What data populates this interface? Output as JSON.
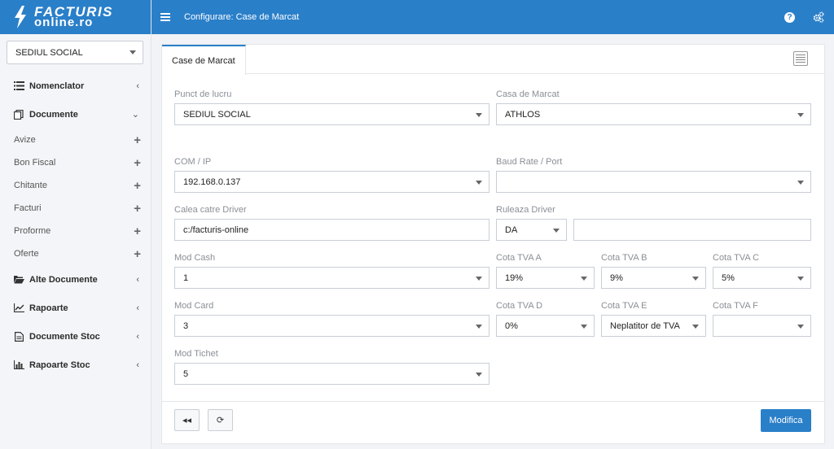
{
  "brand": {
    "line1": "FACTURIS",
    "line2": "online.ro"
  },
  "header": {
    "title": "Configurare: Case de Marcat"
  },
  "sidebar": {
    "site": "SEDIUL SOCIAL",
    "items": [
      {
        "label": "Nomenclator"
      },
      {
        "label": "Documente"
      },
      {
        "label": "Alte Documente"
      },
      {
        "label": "Rapoarte"
      },
      {
        "label": "Documente Stoc"
      },
      {
        "label": "Rapoarte Stoc"
      }
    ],
    "documente_sub": [
      {
        "label": "Avize"
      },
      {
        "label": "Bon Fiscal"
      },
      {
        "label": "Chitante"
      },
      {
        "label": "Facturi"
      },
      {
        "label": "Proforme"
      },
      {
        "label": "Oferte"
      }
    ]
  },
  "tab": {
    "label": "Case de Marcat"
  },
  "form": {
    "punct_label": "Punct de lucru",
    "punct_value": "SEDIUL SOCIAL",
    "casa_label": "Casa de Marcat",
    "casa_value": "ATHLOS",
    "com_label": "COM / IP",
    "com_value": "192.168.0.137",
    "baud_label": "Baud Rate / Port",
    "baud_value": "",
    "driver_label": "Calea catre Driver",
    "driver_value": "c:/facturis-online",
    "ruleaza_label": "Ruleaza Driver",
    "ruleaza_value": "DA",
    "ruleaza_extra": "",
    "modcash_label": "Mod Cash",
    "modcash_value": "1",
    "tvaA_label": "Cota TVA A",
    "tvaA_value": "19%",
    "tvaB_label": "Cota TVA B",
    "tvaB_value": "9%",
    "tvaC_label": "Cota TVA C",
    "tvaC_value": "5%",
    "modcard_label": "Mod Card",
    "modcard_value": "3",
    "tvaD_label": "Cota TVA D",
    "tvaD_value": "0%",
    "tvaE_label": "Cota TVA E",
    "tvaE_value": "Neplatitor de TVA",
    "tvaF_label": "Cota TVA F",
    "tvaF_value": "",
    "modtichet_label": "Mod Tichet",
    "modtichet_value": "5"
  },
  "actions": {
    "back": "◂◂",
    "refresh": "⟳",
    "submit": "Modifica"
  },
  "colors": {
    "accent": "#2a7fc9"
  }
}
